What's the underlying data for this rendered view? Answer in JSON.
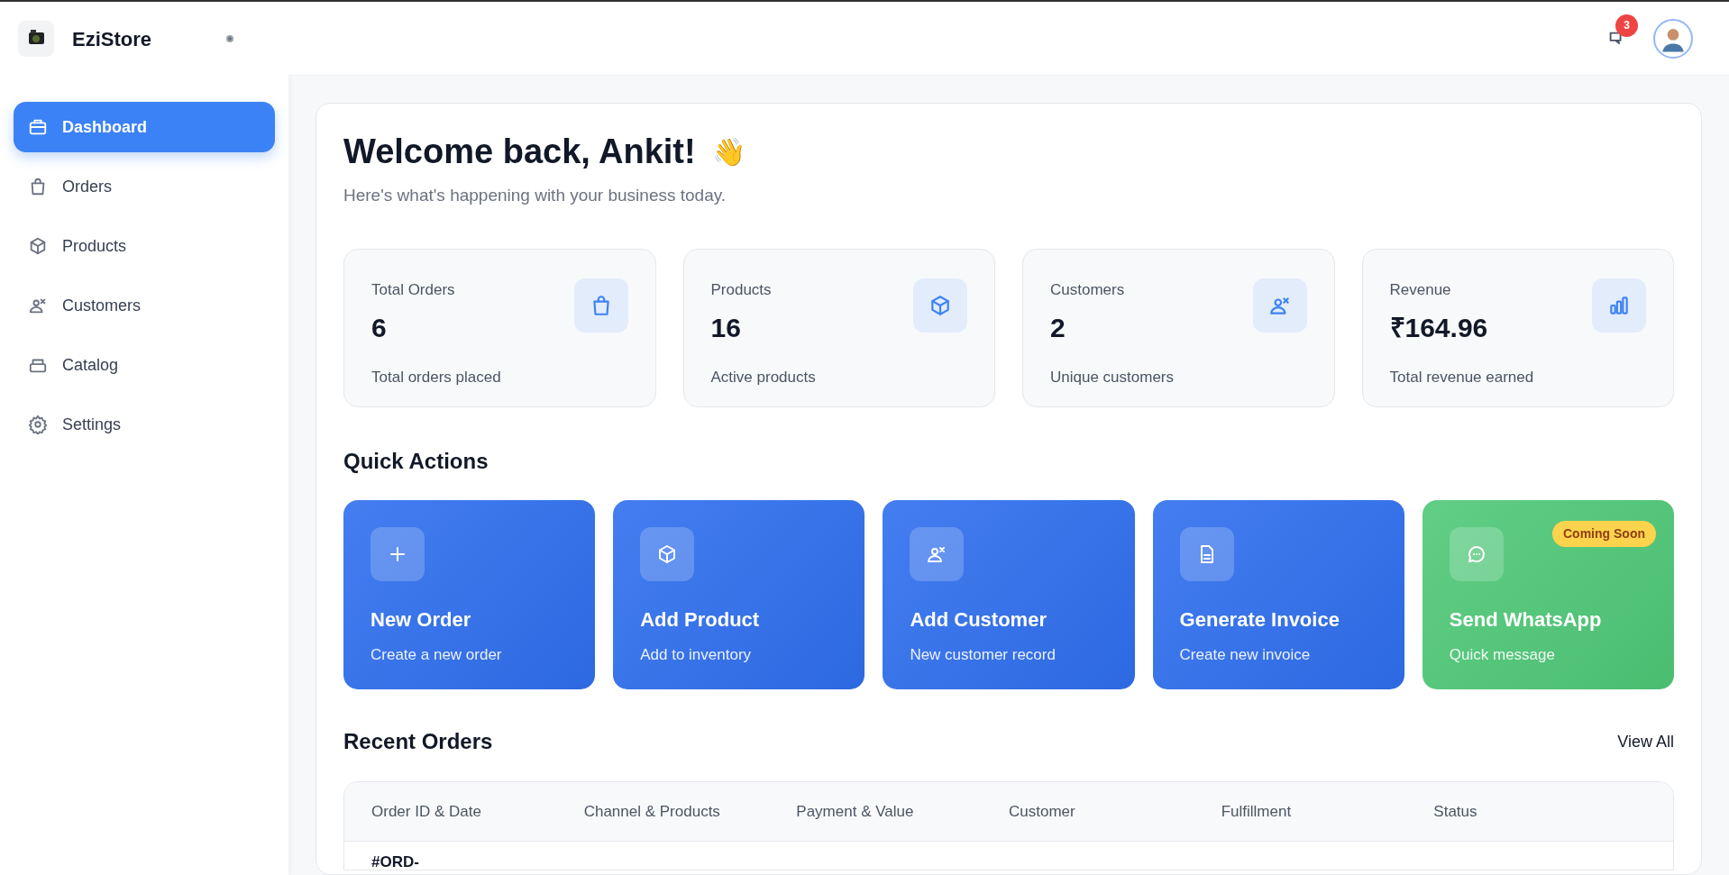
{
  "sidebar": {
    "brand": "EziStore",
    "items": [
      {
        "label": "Dashboard",
        "selected": true
      },
      {
        "label": "Orders",
        "selected": false
      },
      {
        "label": "Products",
        "selected": false
      },
      {
        "label": "Customers",
        "selected": false
      },
      {
        "label": "Catalog",
        "selected": false
      },
      {
        "label": "Settings",
        "selected": false
      }
    ]
  },
  "header": {
    "notification_count": "3"
  },
  "welcome": {
    "title": "Welcome back, Ankit!",
    "emoji": "👋",
    "subtitle": "Here's what's happening with your business today."
  },
  "stats": [
    {
      "label": "Total Orders",
      "value": "6",
      "caption": "Total orders placed"
    },
    {
      "label": "Products",
      "value": "16",
      "caption": "Active products"
    },
    {
      "label": "Customers",
      "value": "2",
      "caption": "Unique customers"
    },
    {
      "label": "Revenue",
      "value": "₹164.96",
      "caption": "Total revenue earned"
    }
  ],
  "quick_actions": {
    "title": "Quick Actions",
    "items": [
      {
        "title": "New Order",
        "subtitle": "Create a new order",
        "color": "#2f6fef"
      },
      {
        "title": "Add Product",
        "subtitle": "Add to inventory",
        "color": "#2f6fef"
      },
      {
        "title": "Add Customer",
        "subtitle": "New customer record",
        "color": "#2f6fef"
      },
      {
        "title": "Generate Invoice",
        "subtitle": "Create new invoice",
        "color": "#2f6fef"
      },
      {
        "title": "Send WhatsApp",
        "subtitle": "Quick message",
        "color": "#4fc978",
        "badge": "Coming Soon"
      }
    ]
  },
  "recent_orders": {
    "title": "Recent Orders",
    "view_all": "View All",
    "columns": [
      "Order ID & Date",
      "Channel & Products",
      "Payment & Value",
      "Customer",
      "Fulfillment",
      "Status"
    ],
    "rows": [
      [
        "#ORD-"
      ]
    ]
  }
}
